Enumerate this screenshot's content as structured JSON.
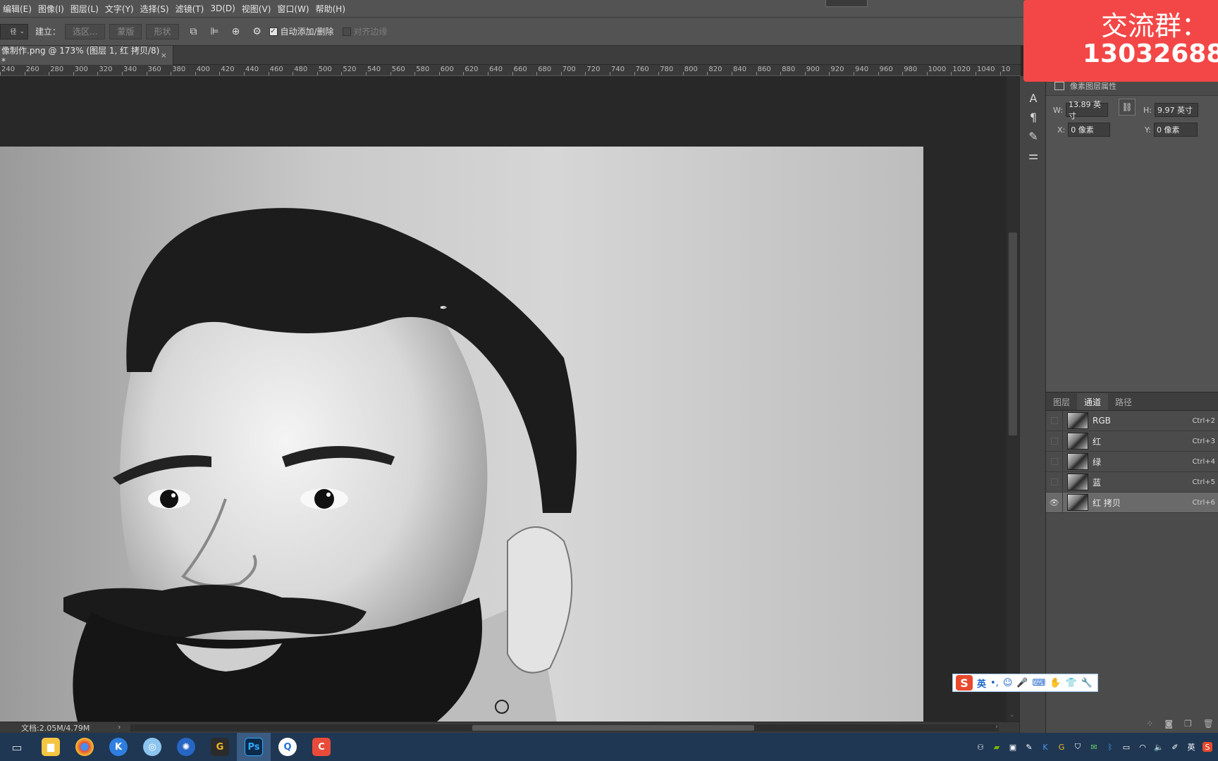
{
  "menubar": {
    "items": [
      "编辑(E)",
      "图像(I)",
      "图层(L)",
      "文字(Y)",
      "选择(S)",
      "滤镜(T)",
      "3D(D)",
      "视图(V)",
      "窗口(W)",
      "帮助(H)"
    ]
  },
  "options": {
    "mode_value": "径",
    "make_label": "建立：",
    "selection_btn": "选区...",
    "mask_btn": "蒙版",
    "shape_btn": "形状",
    "auto_add_delete": "自动添加/删除",
    "align_edges": "对齐边缘"
  },
  "doc_tab": {
    "title": "像制作.png @ 173% (图层 1, 红 拷贝/8) *",
    "close": "×"
  },
  "ruler": {
    "ticks": [
      "240",
      "260",
      "280",
      "300",
      "320",
      "340",
      "360",
      "380",
      "400",
      "420",
      "440",
      "460",
      "480",
      "500",
      "520",
      "540",
      "560",
      "580",
      "600",
      "620",
      "640",
      "660",
      "680",
      "700",
      "720",
      "740",
      "760",
      "780",
      "800",
      "820",
      "840",
      "860",
      "880",
      "900",
      "920",
      "940",
      "960",
      "980",
      "1000",
      "1020",
      "1040",
      "10"
    ]
  },
  "status": {
    "doc_size": "文档:2.05M/4.79M",
    "arrow": "›",
    "scroll_left": "‹",
    "scroll_right": "›"
  },
  "properties": {
    "title": "像素图层属性",
    "w_label": "W:",
    "w_value": "13.89 英寸",
    "h_label": "H:",
    "h_value": "9.97 英寸",
    "x_label": "X:",
    "x_value": "0 像素",
    "y_label": "Y:",
    "y_value": "0 像素"
  },
  "channels": {
    "tabs": [
      "图层",
      "通道",
      "路径"
    ],
    "active_tab": 1,
    "rows": [
      {
        "name": "RGB",
        "shortcut": "Ctrl+2",
        "visible": false
      },
      {
        "name": "红",
        "shortcut": "Ctrl+3",
        "visible": false
      },
      {
        "name": "绿",
        "shortcut": "Ctrl+4",
        "visible": false
      },
      {
        "name": "蓝",
        "shortcut": "Ctrl+5",
        "visible": false
      },
      {
        "name": "红 拷贝",
        "shortcut": "Ctrl+6",
        "visible": true
      }
    ]
  },
  "overlay": {
    "line1": "交流群：",
    "line2": "13032688"
  },
  "ime": {
    "lang": "英"
  },
  "taskbar": {
    "apps": [
      "task-view",
      "file-explorer",
      "chrome",
      "kugou",
      "app-blue",
      "app-globe",
      "app-g",
      "photoshop",
      "app-q",
      "app-red"
    ],
    "ps_label": "Ps",
    "tray_lang": "英"
  },
  "colors": {
    "overlay_bg": "#f34747",
    "accent": "#1e63c9",
    "ps_bg": "#31a8ff"
  }
}
